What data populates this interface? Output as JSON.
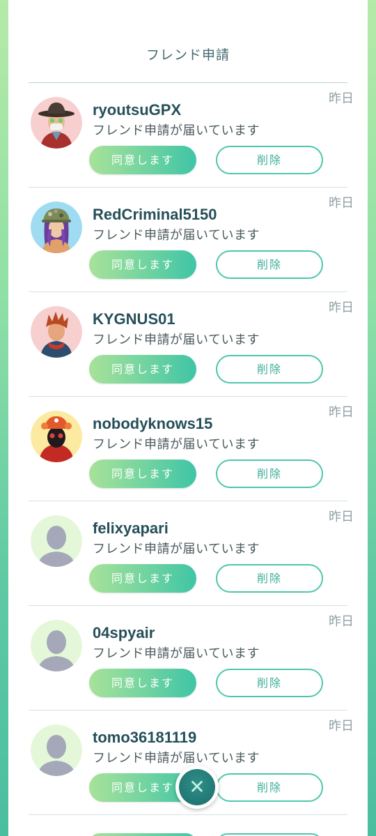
{
  "header": {
    "title": "フレンド申請"
  },
  "requests": [
    {
      "name": "ryoutsuGPX",
      "status": "フレンド申請が届いています",
      "date": "昨日",
      "accept_label": "同意します",
      "delete_label": "削除",
      "avatar": "avatar-hat-masked"
    },
    {
      "name": "RedCriminal5150",
      "status": "フレンド申請が届いています",
      "date": "昨日",
      "accept_label": "同意します",
      "delete_label": "削除",
      "avatar": "avatar-camo-cap-purple-hair"
    },
    {
      "name": "KYGNUS01",
      "status": "フレンド申請が届いています",
      "date": "昨日",
      "accept_label": "同意します",
      "delete_label": "削除",
      "avatar": "avatar-red-hair"
    },
    {
      "name": "nobodyknows15",
      "status": "フレンド申請が届いています",
      "date": "昨日",
      "accept_label": "同意します",
      "delete_label": "削除",
      "avatar": "avatar-orange-cap-dark-face"
    },
    {
      "name": "felixyapari",
      "status": "フレンド申請が届いています",
      "date": "昨日",
      "accept_label": "同意します",
      "delete_label": "削除",
      "avatar": "avatar-default-silhouette"
    },
    {
      "name": "04spyair",
      "status": "フレンド申請が届いています",
      "date": "昨日",
      "accept_label": "同意します",
      "delete_label": "削除",
      "avatar": "avatar-default-silhouette"
    },
    {
      "name": "tomo36181119",
      "status": "フレンド申請が届いています",
      "date": "昨日",
      "accept_label": "同意します",
      "delete_label": "削除",
      "avatar": "avatar-default-silhouette"
    }
  ],
  "close_button": {
    "icon": "close-icon",
    "glyph": "✕"
  },
  "colors": {
    "accent": "#4dc6ab",
    "name_text": "#254f59",
    "background_top": "#b5eaa8",
    "background_bottom": "#4bbea0"
  }
}
